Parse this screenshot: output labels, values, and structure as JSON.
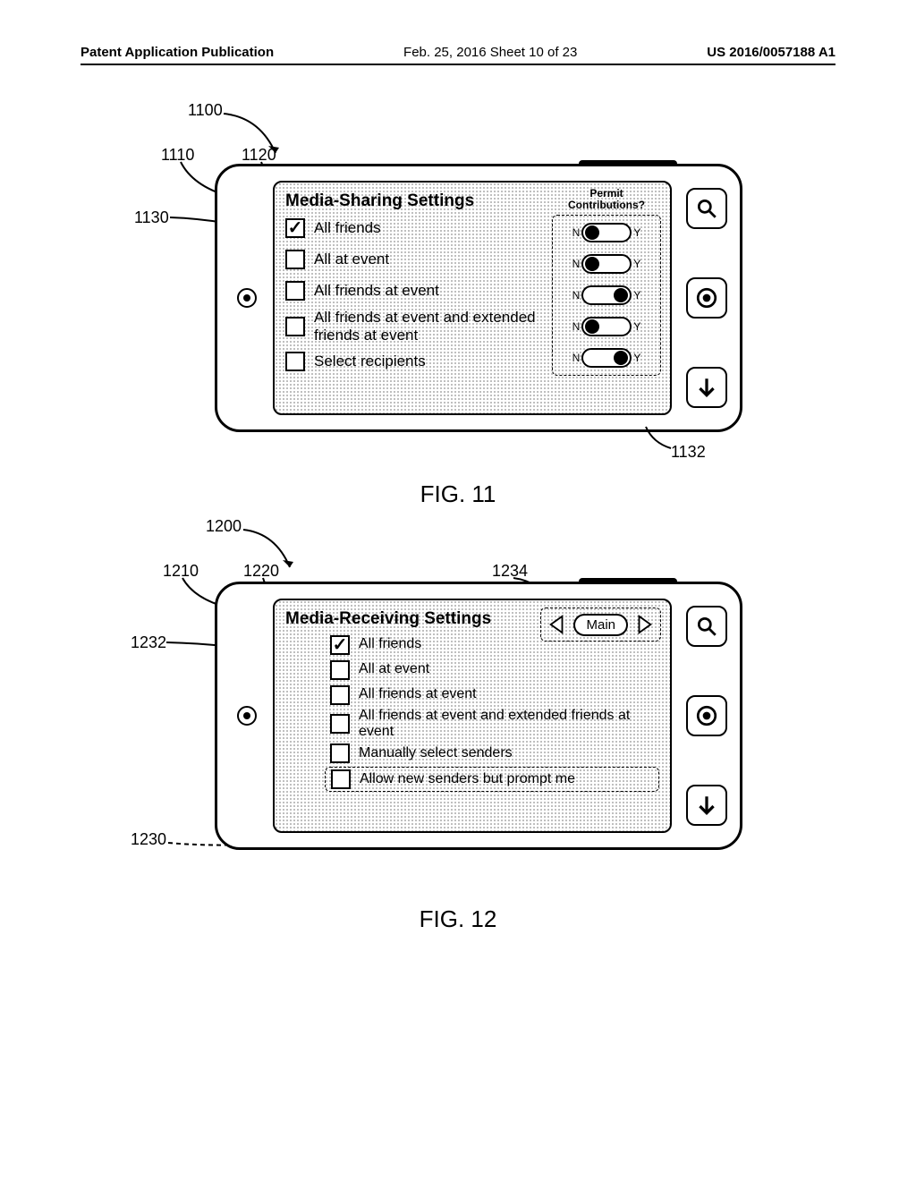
{
  "header": {
    "left": "Patent Application Publication",
    "mid": "Feb. 25, 2016  Sheet 10 of 23",
    "right": "US 2016/0057188 A1"
  },
  "fig11": {
    "label": "FIG. 11",
    "title": "Media-Sharing Settings",
    "permit_header": "Permit\nContributions?",
    "options": [
      {
        "label": "All friends",
        "checked": true,
        "toggle": "N"
      },
      {
        "label": "All at event",
        "checked": false,
        "toggle": "N"
      },
      {
        "label": "All friends at event",
        "checked": false,
        "toggle": "Y"
      },
      {
        "label": "All friends at event and extended friends at event",
        "checked": false,
        "toggle": "N"
      },
      {
        "label": "Select recipients",
        "checked": false,
        "toggle": "Y"
      }
    ],
    "toggle_n": "N",
    "toggle_y": "Y",
    "callouts": {
      "c1100": "1100",
      "c1110": "1110",
      "c1120": "1120",
      "c1130": "1130",
      "c1132": "1132"
    }
  },
  "fig12": {
    "label": "FIG. 12",
    "title": "Media-Receiving Settings",
    "chooser_label": "Main",
    "options": [
      {
        "label": "All friends",
        "checked": true
      },
      {
        "label": "All at event",
        "checked": false
      },
      {
        "label": "All friends at event",
        "checked": false
      },
      {
        "label": "All friends at event and extended friends at event",
        "checked": false
      },
      {
        "label": "Manually select senders",
        "checked": false
      }
    ],
    "extra_option": {
      "label": "Allow new senders but prompt me",
      "checked": false
    },
    "callouts": {
      "c1200": "1200",
      "c1210": "1210",
      "c1220": "1220",
      "c1230": "1230",
      "c1232": "1232",
      "c1234": "1234"
    }
  }
}
